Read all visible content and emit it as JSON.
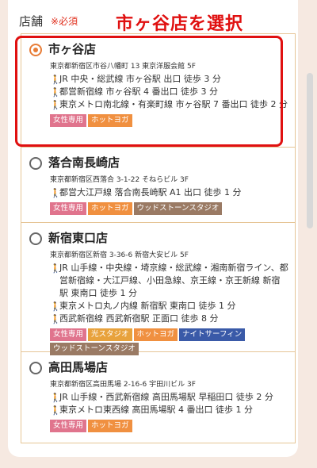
{
  "header": {
    "label": "店舗",
    "required": "※必須"
  },
  "caption": "市ヶ谷店を選択",
  "stores": [
    {
      "name": "市ヶ谷店",
      "selected": true,
      "address": "東京都新宿区市谷八幡町 13 東京洋服会館 5F",
      "access": [
        "JR 中央・総武線 市ヶ谷駅 出口 徒歩 3 分",
        "都営新宿線 市ヶ谷駅 4 番出口 徒歩 3 分",
        "東京メトロ南北線・有楽町線 市ヶ谷駅 7 番出口 徒歩 2 分"
      ],
      "tags": [
        "女性専用",
        "ホットヨガ"
      ]
    },
    {
      "name": "落合南長崎店",
      "selected": false,
      "address": "東京都新宿区西落合 3-1-22 そねらビル 3F",
      "access": [
        "都営大江戸線 落合南長崎駅 A1 出口 徒歩 1 分"
      ],
      "tags": [
        "女性専用",
        "ホットヨガ",
        "ウッドストーンスタジオ"
      ]
    },
    {
      "name": "新宿東口店",
      "selected": false,
      "address": "東京都新宿区新宿 3-36-6 新宿大安ビル 5F",
      "access": [
        "JR 山手線・中央線・埼京線・総武線・湘南新宿ライン、都営新宿線・大江戸線、小田急線、京王線・京王新線 新宿駅 東南口 徒歩 1 分",
        "東京メトロ丸ノ内線 新宿駅 東南口 徒歩 1 分",
        "西武新宿線 西武新宿駅 正面口 徒歩 8 分"
      ],
      "tags": [
        "女性専用",
        "光スタジオ",
        "ホットヨガ",
        "ナイトサーフィン",
        "ウッドストーンスタジオ"
      ]
    },
    {
      "name": "高田馬場店",
      "selected": false,
      "address": "東京都新宿区高田馬場 2-16-6 宇田川ビル 3F",
      "access": [
        "JR 山手線・西武新宿線 高田馬場駅 早稲田口 徒歩 2 分",
        "東京メトロ東西線 高田馬場駅 4 番出口 徒歩 1 分"
      ],
      "tags": [
        "女性専用",
        "ホットヨガ"
      ]
    }
  ]
}
